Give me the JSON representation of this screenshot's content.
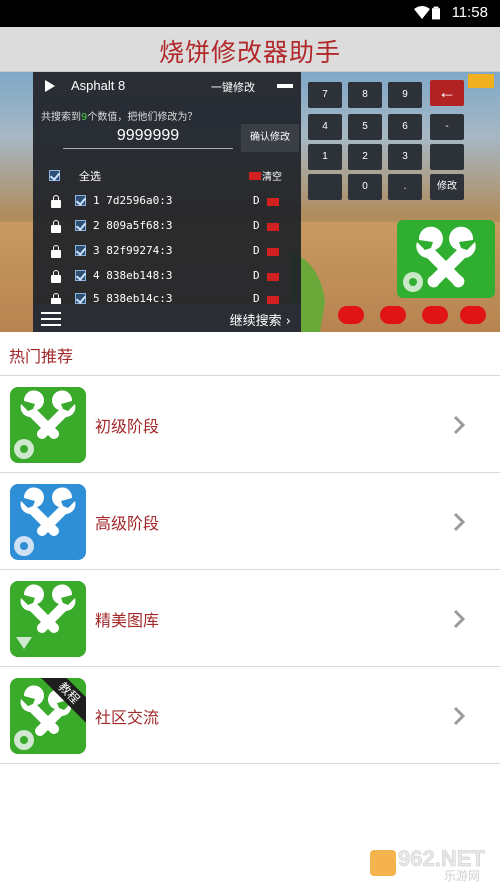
{
  "status": {
    "time": "11:58"
  },
  "app": {
    "title": "烧饼修改器助手"
  },
  "banner": {
    "game": "Asphalt 8",
    "onekey": "一键修改",
    "found_prefix": "共搜索到",
    "found_count": "9",
    "found_suffix": "个数值，把他们修改为？",
    "value": "9999999",
    "confirm": "确认修改",
    "select_all": "全选",
    "clear": "清空",
    "rows": [
      {
        "text": "1 7d2596a0:3",
        "type": "D"
      },
      {
        "text": "2 809a5f68:3",
        "type": "D"
      },
      {
        "text": "3 82f99274:3",
        "type": "D"
      },
      {
        "text": "4 838eb148:3",
        "type": "D"
      },
      {
        "text": "5 838eb14c:3",
        "type": "D"
      }
    ],
    "continue": "继续搜索",
    "keys": [
      "7",
      "8",
      "9",
      "4",
      "5",
      "6",
      "-",
      "1",
      "2",
      "3",
      "0",
      ".",
      "修改"
    ]
  },
  "section": {
    "title": "热门推荐"
  },
  "items": [
    {
      "label": "初级阶段",
      "color": "#3aaa2a"
    },
    {
      "label": "高级阶段",
      "color": "#2f8fd6"
    },
    {
      "label": "精美图库",
      "color": "#3aaa2a"
    },
    {
      "label": "社区交流",
      "color": "#3aaa2a",
      "badge": "教程"
    }
  ],
  "watermark": {
    "brand": "962.NET",
    "sub": "乐游网"
  }
}
